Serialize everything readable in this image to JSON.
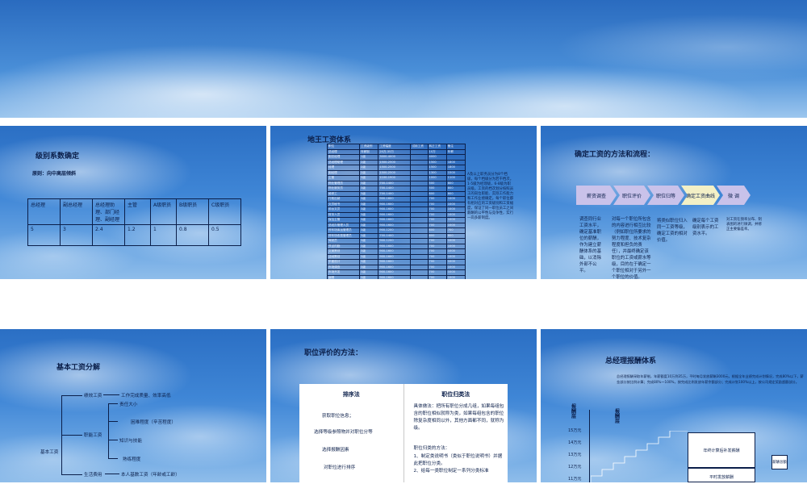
{
  "slide1": {
    "title": "级别系数确定",
    "subtitle": "原则：向中高层倾斜",
    "headers": [
      "总经理",
      "副总经理",
      "总经理助理、部门经理、副经理",
      "主管",
      "A级职员",
      "B级职员",
      "C级职员"
    ],
    "values": [
      "5",
      "3",
      "2.4",
      "1.2",
      "1",
      "0.8",
      "0.5"
    ]
  },
  "slide2": {
    "title": "地王工资体系",
    "table_headers": [
      "职位",
      "工资级别",
      "工资幅度",
      "试用工资",
      "转正工资",
      "备注"
    ],
    "rows": [
      [
        "总经理",
        "年薪制",
        "20万-35万",
        "",
        "10万",
        "年薪"
      ],
      [
        "副总经理",
        "1级",
        "3000-4000",
        "",
        "4000",
        ""
      ],
      [
        "总经理助理",
        "2级",
        "1500-2500",
        "",
        "1500",
        "1800"
      ],
      [
        "经理",
        "2级",
        "1500-2500",
        "",
        "1500",
        "1800"
      ],
      [
        "副经理",
        "2级",
        "1500-2500",
        "",
        "1300",
        "1500"
      ],
      [
        "主管",
        "3级",
        "1100-1900",
        "",
        "1000",
        "1100"
      ],
      [
        "物业管理员",
        "3级",
        "700-1400",
        "",
        "500",
        "800"
      ],
      [
        "物业服务员",
        "3级",
        "700-1400",
        "",
        "500",
        "800"
      ],
      [
        "维修工",
        "3级",
        "700-1400",
        "",
        "600",
        "800"
      ],
      [
        "行政出纳",
        "3级",
        "900-1600",
        "",
        "700",
        "1000"
      ],
      [
        "文员秘书",
        "3级",
        "900-1600",
        "",
        "700",
        "1000"
      ],
      [
        "前台文员",
        "3级",
        "900-1600",
        "",
        "700",
        "1000"
      ],
      [
        "财务人员",
        "3级",
        "900-1600",
        "",
        "700",
        "1000"
      ],
      [
        "保洁主管",
        "3级",
        "900-1600",
        "",
        "700",
        "1000"
      ],
      [
        "总经办管理人员",
        "3级",
        "900-1600",
        "",
        "700",
        "1000"
      ],
      [
        "停车场库运管理员",
        "3级",
        "900-1200",
        "",
        "600",
        "700"
      ],
      [
        "停车场收费管理员",
        "3级",
        "700-1400",
        "",
        "600",
        "800"
      ],
      [
        "驾驶员",
        "3级",
        "900-1200",
        "",
        "700",
        "1000"
      ],
      [
        "节点内勤",
        "3级",
        "900-1600",
        "",
        "700",
        "1000"
      ],
      [
        "文案策划",
        "3级",
        "900-1600",
        "",
        "700",
        "1000"
      ],
      [
        "活动策划",
        "3级",
        "900-1600",
        "",
        "700",
        "1000"
      ],
      [
        "平面设计",
        "3级",
        "900-1600",
        "",
        "700",
        "1000"
      ],
      [
        "市场调查",
        "3级",
        "900-1600",
        "",
        "700",
        "1000"
      ],
      [
        "市场开发",
        "3级",
        "900-1600",
        "",
        "700",
        "1000"
      ],
      [
        "编辑",
        "3级",
        "900-1600",
        "",
        "700",
        "1000"
      ],
      [
        "文秘",
        "3级",
        "900-1600",
        "",
        "700",
        "1000"
      ],
      [
        "人事员",
        "3级",
        "900-1600",
        "",
        "700",
        "1000"
      ],
      [
        "行政员",
        "3级",
        "900-1600",
        "",
        "700",
        "1000"
      ],
      [
        "资料员",
        "3级",
        "700-1400",
        "",
        "600",
        "800"
      ],
      [
        "会计",
        "3级",
        "700-1400",
        "",
        "600",
        "800"
      ],
      [
        "出纳",
        "3级",
        "700-1400",
        "",
        "600",
        "800"
      ]
    ],
    "note": "A及以上职务员分为8个档级，每个档级分为若干档次。1-5级为经理级，6-8级为职员级。工资的档次划分按照员工的岗位职能、实际工作能力和工作业绩确定。每个职位都有相对应的工资级别和工资幅度，保证了同一职位员工之间薪酬的公平性与竞争性，实行一岗多薪制度。"
  },
  "slide3": {
    "title": "确定工资的方法和流程：",
    "steps": [
      "薪资调查",
      "职位评价",
      "职位归等",
      "确定工资曲线",
      "微 调"
    ],
    "descs": [
      "调查同行业工资水平，确定基准职位的薪酬，作为建立薪酬体系的基础，以消除外部不公平。",
      "对每一个职位所包含的内容进行相互比较（例如职位所要求的努力程度、技术复杂程度和担负的责任），并最终确定该职位的工资或薪水等级，目的在于确定一个职位相对于另外一个职位的价值。",
      "将类似职位归入同一工资等级，确定工资的相对价值。",
      "确定每个工资级别表示的工资水平。",
      "对工资在频率分布、制表图的进行微调，并修正主要偏差率。"
    ]
  },
  "slide4": {
    "title": "基本工资分解",
    "root": "基本工资",
    "branch1": "绩效工资",
    "branch1_desc": "工作完成质量、效率高低",
    "branch2": "职能工资",
    "branch2_items": [
      "责任大小",
      "困难程度（辛苦程度）",
      "知识与技能",
      "熟练程度"
    ],
    "branch3": "生活费用",
    "branch3_desc": "本人基数工资（年龄或工龄）"
  },
  "slide5": {
    "title": "职位评价的方法：",
    "left_header": "排序法",
    "left_items": [
      "获取职位信息；",
      "选择等级参照物并对职位分等",
      "选择报酬因素",
      "对职位进行排序"
    ],
    "right_header": "职位归类法",
    "right_text": "具体做法：把所有职位分成几组，如果每组包含的职位相似就称为类，如果每组包含的职位除复杂度相同以外，其他方面都不同，就称为级。",
    "right_sub_title": "职位归类的方法：",
    "right_sub_items": [
      "1、制定类说明书（类似于职位说明书）并据此把职位分类。",
      "2、给每一类职位制定一系列分类标准"
    ]
  },
  "slide6": {
    "title": "总经理报酬体系",
    "paragraph": "总经理报酬采取年薪制，年薪额度10万到35万，平时每月发放薪酬3000元，根据全年业绩完成计划情况，完成80%以下，薪金部分按比例计算；完成80%～100%，按完成比例发放年薪余额部分；完成计划100%以上，按公司规定奖励超额部分。",
    "y_label": "报酬层",
    "y2_label": "报酬层",
    "y_ticks": [
      "15万元",
      "14万元",
      "13万元",
      "12万元",
      "11万元"
    ],
    "box_top": "年终计算后补发薪酬",
    "box_bottom": "平时发放薪酬",
    "side_box": "薪酬总额"
  },
  "colors": {
    "text": "#0b1f4a",
    "step": "#c9c2ea",
    "step_highlight": "#f3f0c6"
  }
}
